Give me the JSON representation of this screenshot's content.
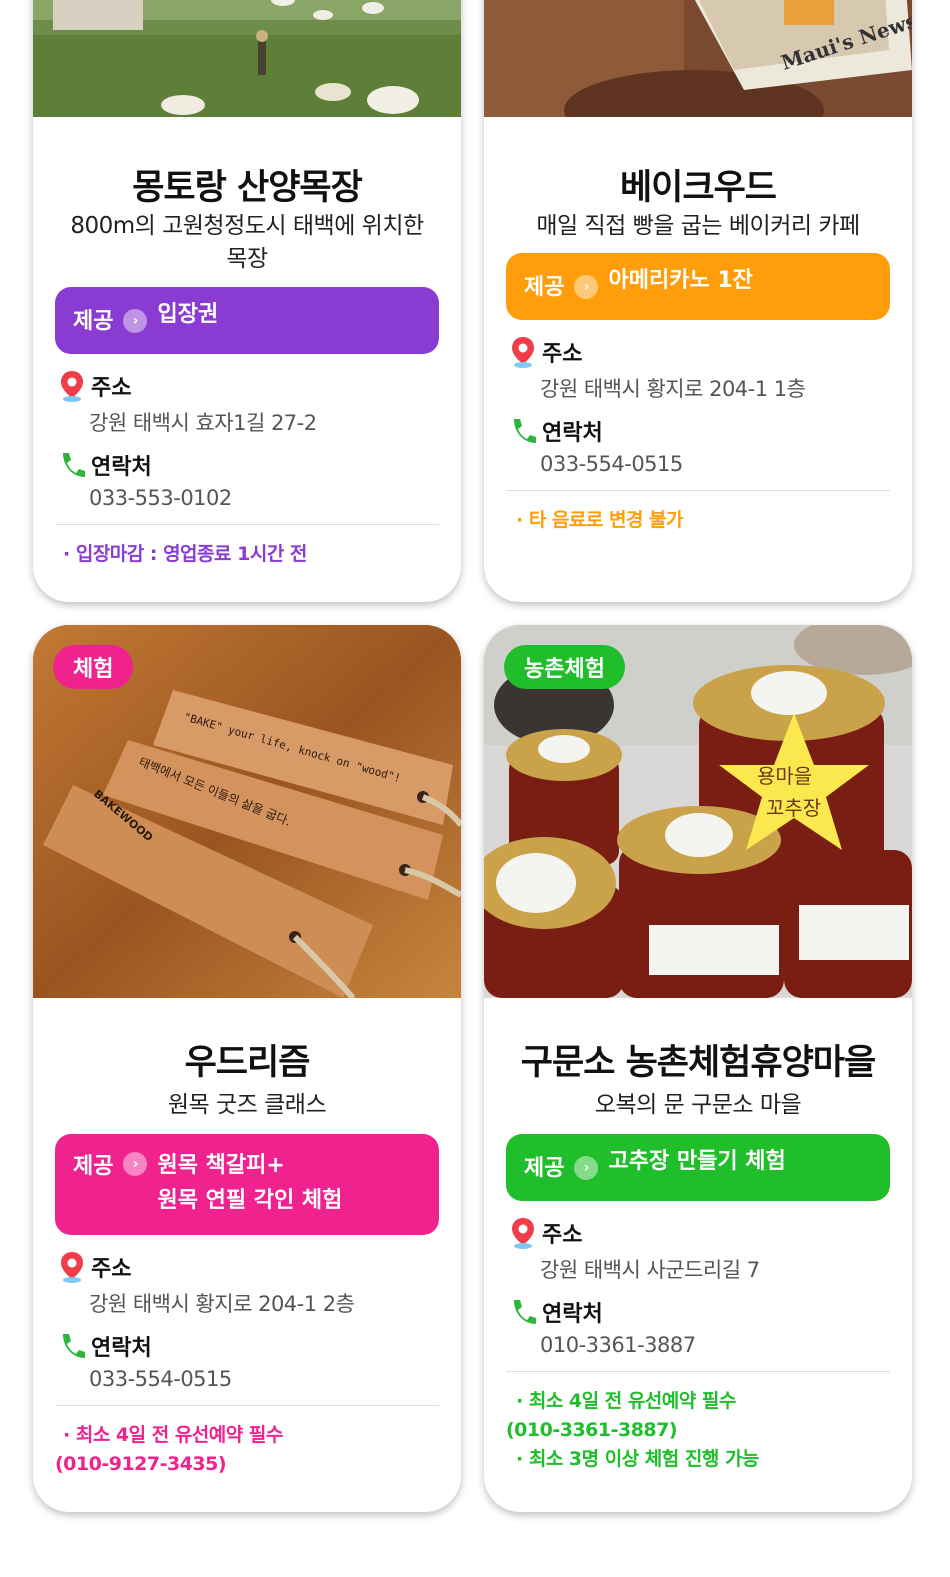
{
  "cards": [
    {
      "title": "몽토랑 산양목장",
      "desc": "800m의 고원청정도시 태백에 위치한 목장",
      "offer": {
        "prefix": "제공",
        "text": "입장권",
        "color": "#8a3bd1"
      },
      "address_label": "주소",
      "address": "강원 태백시 효자1길 27-2",
      "contact_label": "연락처",
      "phone": "033-553-0102",
      "notes": [
        "· 입장마감 : 영업종료 1시간 전"
      ],
      "note_color": "#8a3bd1"
    },
    {
      "title": "베이크우드",
      "desc": "매일 직접 빵을 굽는 베이커리 카페",
      "offer": {
        "prefix": "제공",
        "text": "아메리카노 1잔",
        "color": "#ff9d0a"
      },
      "address_label": "주소",
      "address": "강원 태백시 황지로 204-1 1층",
      "contact_label": "연락처",
      "phone": "033-554-0515",
      "notes": [
        "· 타 음료로 변경 불가"
      ],
      "note_color": "#ff9d0a"
    },
    {
      "badge": "체험",
      "badge_color": "#f0228e",
      "title": "우드리즘",
      "desc": "원목 굿즈 클래스",
      "offer": {
        "prefix": "제공",
        "text_line1": "원목 책갈피+",
        "text_line2": "원목 연필 각인 체험",
        "color": "#f0228e"
      },
      "address_label": "주소",
      "address": "강원 태백시 황지로 204-1 2층",
      "contact_label": "연락처",
      "phone": "033-554-0515",
      "notes": [
        "· 최소 4일 전 유선예약 필수",
        "(010-9127-3435)"
      ],
      "note_color": "#f0228e",
      "photo_text": [
        "\"BAKE\" your life, knock on \"wood\"!",
        "태백에서 모든 이들의 삶을 굽다.",
        "BAKEWOOD"
      ]
    },
    {
      "badge": "농촌체험",
      "badge_color": "#1fbe2a",
      "title": "구문소 농촌체험휴양마을",
      "desc": "오복의 문 구문소 마을",
      "offer": {
        "prefix": "제공",
        "text": "고추장 만들기 체험",
        "color": "#1fbe2a"
      },
      "address_label": "주소",
      "address": "강원 태백시 사군드리길 7",
      "contact_label": "연락처",
      "phone": "010-3361-3887",
      "notes": [
        "· 최소 4일 전 유선예약 필수",
        "(010-3361-3887)",
        "· 최소 3명 이상 체험 진행 가능"
      ],
      "note_color": "#1fbe2a",
      "photo_text": [
        "용마을",
        "꼬추장"
      ]
    }
  ],
  "photo1_sign": "Maui's News"
}
